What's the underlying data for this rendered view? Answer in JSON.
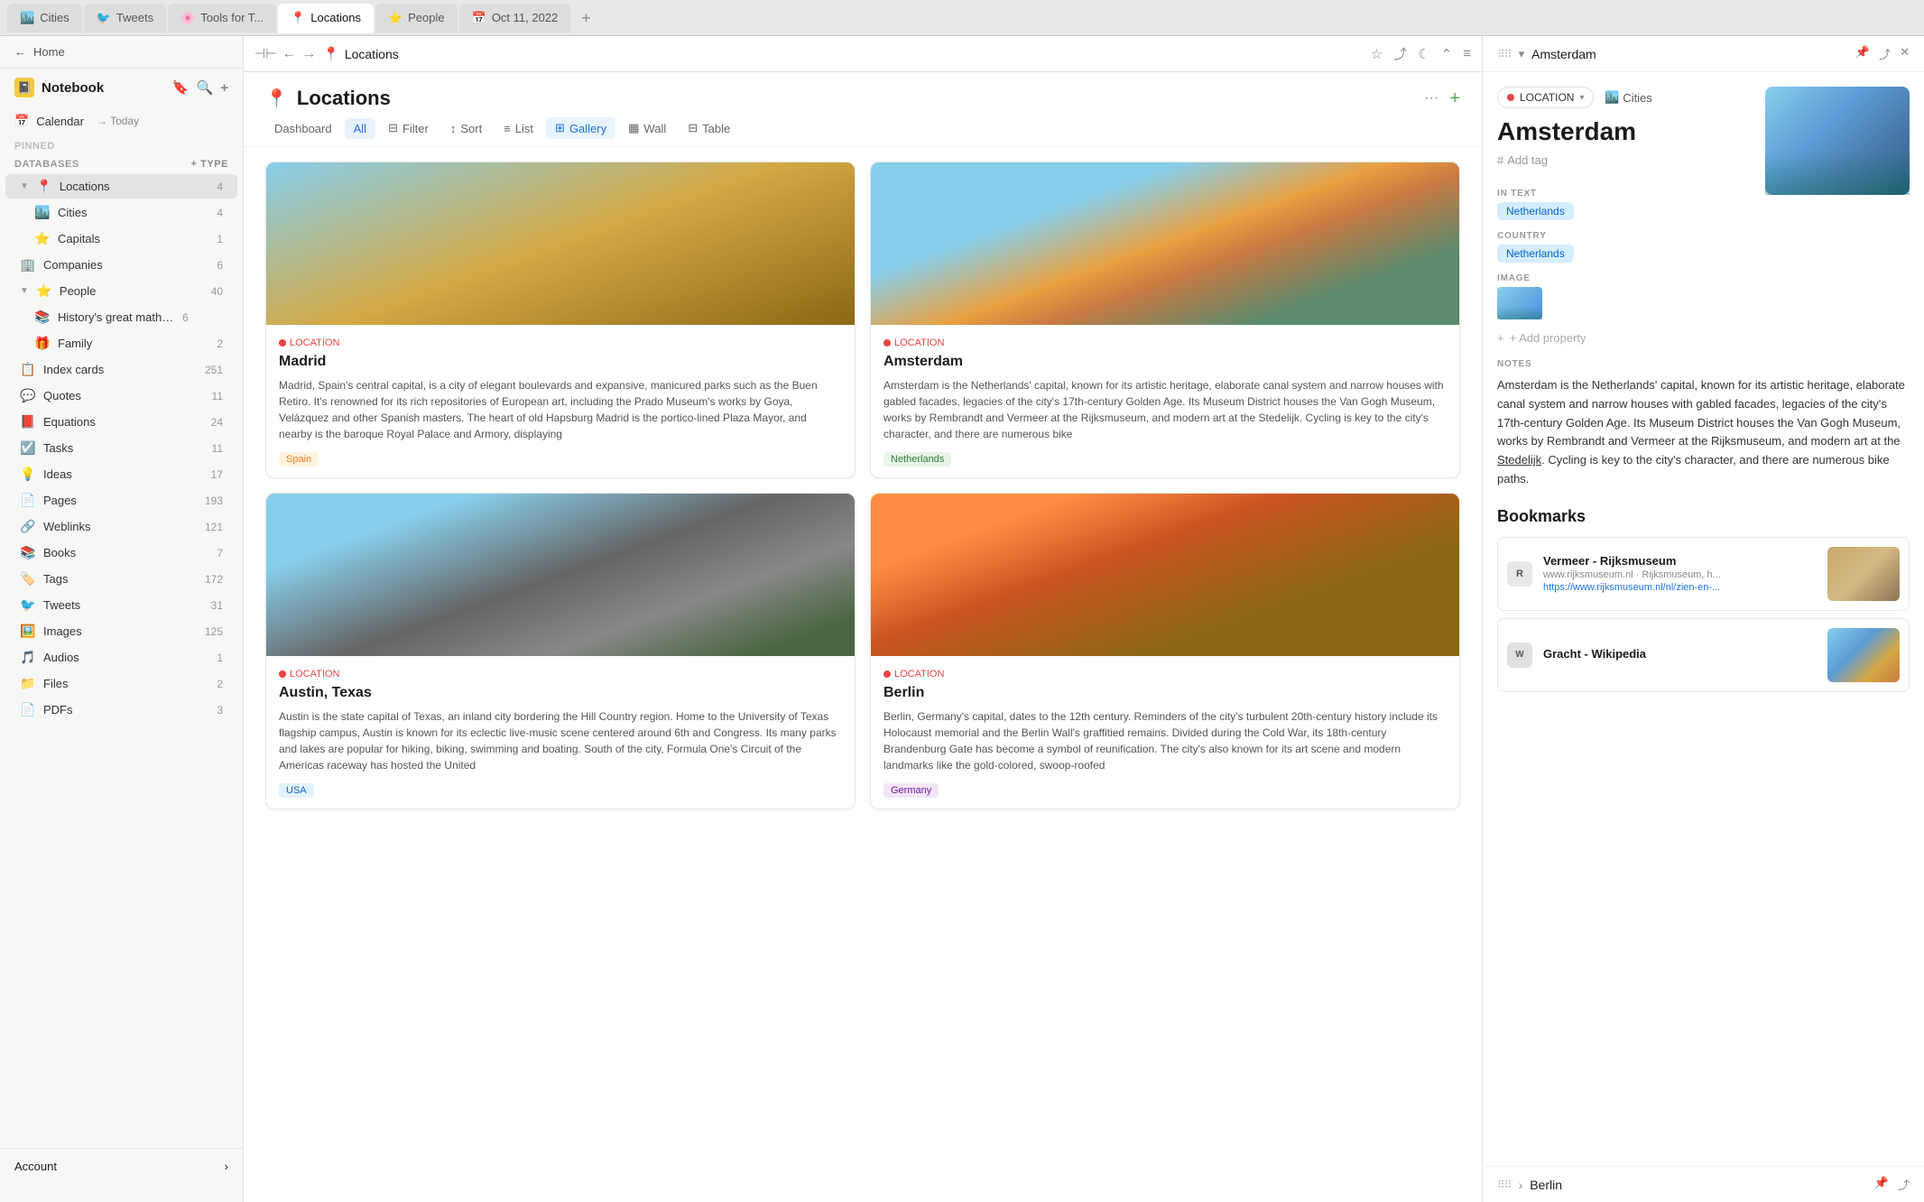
{
  "tabs": [
    {
      "id": "cities",
      "label": "Cities",
      "icon": "🏙️",
      "active": false
    },
    {
      "id": "tweets",
      "label": "Tweets",
      "icon": "🐦",
      "active": false
    },
    {
      "id": "tools",
      "label": "Tools for T...",
      "icon": "🌸",
      "active": false
    },
    {
      "id": "locations",
      "label": "Locations",
      "icon": "📍",
      "active": true
    },
    {
      "id": "people",
      "label": "People",
      "icon": "⭐",
      "active": false
    },
    {
      "id": "date",
      "label": "Oct 11, 2022",
      "icon": "📅",
      "active": false
    }
  ],
  "toolbar": {
    "back_icon": "←",
    "forward_icon": "→",
    "title": "Locations",
    "title_icon": "📍"
  },
  "sidebar": {
    "home_label": "Home",
    "notebook_label": "Notebook",
    "pinned_label": "PINNED",
    "databases_label": "DATABASES",
    "calendar_label": "Calendar",
    "today_label": "→ Today",
    "items": [
      {
        "id": "locations",
        "icon": "📍",
        "label": "Locations",
        "count": "4",
        "active": true,
        "expanded": true,
        "color": "#e84444"
      },
      {
        "id": "cities",
        "icon": "🏙️",
        "label": "Cities",
        "count": "4",
        "indent": 1
      },
      {
        "id": "capitals",
        "icon": "⭐",
        "label": "Capitals",
        "count": "1",
        "indent": 1
      },
      {
        "id": "companies",
        "icon": "🏢",
        "label": "Companies",
        "count": "6",
        "indent": 0
      },
      {
        "id": "people",
        "icon": "⭐",
        "label": "People",
        "count": "40",
        "expanded": true,
        "indent": 0
      },
      {
        "id": "history",
        "icon": "📚",
        "label": "History's great mathe...",
        "count": "6",
        "indent": 1
      },
      {
        "id": "family",
        "icon": "🎁",
        "label": "Family",
        "count": "2",
        "indent": 1
      },
      {
        "id": "index-cards",
        "icon": "📋",
        "label": "Index cards",
        "count": "251",
        "indent": 0
      },
      {
        "id": "quotes",
        "icon": "💬",
        "label": "Quotes",
        "count": "11",
        "indent": 0
      },
      {
        "id": "equations",
        "icon": "📕",
        "label": "Equations",
        "count": "24",
        "indent": 0
      },
      {
        "id": "tasks",
        "icon": "☑️",
        "label": "Tasks",
        "count": "11",
        "indent": 0
      },
      {
        "id": "ideas",
        "icon": "💡",
        "label": "Ideas",
        "count": "17",
        "indent": 0
      },
      {
        "id": "pages",
        "icon": "📄",
        "label": "Pages",
        "count": "193",
        "indent": 0
      },
      {
        "id": "weblinks",
        "icon": "🔗",
        "label": "Weblinks",
        "count": "121",
        "indent": 0
      },
      {
        "id": "books",
        "icon": "📚",
        "label": "Books",
        "count": "7",
        "indent": 0
      },
      {
        "id": "tags",
        "icon": "🏷️",
        "label": "Tags",
        "count": "172",
        "indent": 0
      },
      {
        "id": "tweets",
        "icon": "🐦",
        "label": "Tweets",
        "count": "31",
        "indent": 0
      },
      {
        "id": "images",
        "icon": "🖼️",
        "label": "Images",
        "count": "125",
        "indent": 0
      },
      {
        "id": "audios",
        "icon": "🎵",
        "label": "Audios",
        "count": "1",
        "indent": 0
      },
      {
        "id": "files",
        "icon": "📁",
        "label": "Files",
        "count": "2",
        "indent": 0
      },
      {
        "id": "pdfs",
        "icon": "📄",
        "label": "PDFs",
        "count": "3",
        "indent": 0
      }
    ],
    "account_label": "Account"
  },
  "page": {
    "title": "Locations",
    "title_icon": "📍",
    "view_tabs": [
      {
        "id": "dashboard",
        "label": "Dashboard",
        "active": false
      },
      {
        "id": "all",
        "label": "All",
        "active": true
      },
      {
        "id": "filter",
        "label": "Filter",
        "icon": "⊟",
        "active": false
      },
      {
        "id": "sort",
        "label": "Sort",
        "icon": "↕",
        "active": false
      },
      {
        "id": "list",
        "label": "List",
        "icon": "≡",
        "active": false
      },
      {
        "id": "gallery",
        "label": "Gallery",
        "icon": "⊞",
        "active": true
      },
      {
        "id": "wall",
        "label": "Wall",
        "icon": "▦",
        "active": false
      },
      {
        "id": "table",
        "label": "Table",
        "icon": "⊟",
        "active": false
      }
    ]
  },
  "cards": [
    {
      "id": "madrid",
      "badge": "LOCATION",
      "title": "Madrid",
      "description": "Madrid, Spain's central capital, is a city of elegant boulevards and expansive, manicured parks such as the Buen Retiro. It's renowned for its rich repositories of European art, including the Prado Museum's works by Goya, Velázquez and other Spanish masters. The heart of old Hapsburg Madrid is the portico-lined Plaza Mayor, and nearby is the baroque Royal Palace and Armory, displaying",
      "tag": "Spain",
      "tag_class": "spain",
      "img_class": "madrid-img"
    },
    {
      "id": "amsterdam",
      "badge": "LOCATION",
      "title": "Amsterdam",
      "description": "Amsterdam is the Netherlands' capital, known for its artistic heritage, elaborate canal system and narrow houses with gabled facades, legacies of the city's 17th-century Golden Age. Its Museum District houses the Van Gogh Museum, works by Rembrandt and Vermeer at the Rijksmuseum, and modern art at the Stedelijk. Cycling is key to the city's character, and there are numerous bike",
      "tag": "Netherlands",
      "tag_class": "netherlands",
      "img_class": "amsterdam-img"
    },
    {
      "id": "austin",
      "badge": "LOCATION",
      "title": "Austin, Texas",
      "description": "Austin is the state capital of Texas, an inland city bordering the Hill Country region. Home to the University of Texas flagship campus, Austin is known for its eclectic live-music scene centered around 6th and Congress. Its many parks and lakes are popular for hiking, biking, swimming and boating. South of the city, Formula One's Circuit of the Americas raceway has hosted the United",
      "tag": "USA",
      "tag_class": "usa",
      "img_class": "austin-img"
    },
    {
      "id": "berlin",
      "badge": "LOCATION",
      "title": "Berlin",
      "description": "Berlin, Germany's capital, dates to the 12th century. Reminders of the city's turbulent 20th-century history include its Holocaust memorial and the Berlin Wall's graffitied remains. Divided during the Cold War, its 18th-century Brandenburg Gate has become a symbol of reunification. The city's also known for its art scene and modern landmarks like the gold-colored, swoop-roofed",
      "tag": "Germany",
      "tag_class": "germany",
      "img_class": "berlin-img"
    }
  ],
  "right_panel": {
    "title": "Amsterdam",
    "city_title": "Amsterdam",
    "type_label": "LOCATION",
    "type_link": "Cities",
    "add_tag": "Add tag",
    "in_text_label": "IN TEXT",
    "in_text_value": "Netherlands",
    "country_label": "COUNTRY",
    "country_value": "Netherlands",
    "image_label": "IMAGE",
    "add_property": "+ Add property",
    "notes_label": "NOTES",
    "notes_text": "Amsterdam is the Netherlands' capital, known for its artistic heritage, elaborate canal system and narrow houses with gabled facades, legacies of the city's 17th-century Golden Age. Its Museum District houses the Van Gogh Museum, works by Rembrandt and Vermeer at the Rijksmuseum, and modern art at the Stedelijk. Cycling is key to the city's character, and there are numerous bike paths.",
    "bookmarks_title": "Bookmarks",
    "bookmarks": [
      {
        "id": "rijksmuseum",
        "name": "Vermeer - Rijksmuseum",
        "favicon_letter": "R",
        "domain": "www.rijksmuseum.nl · Rijksmuseum, h...",
        "url": "https://www.rijksmuseum.nl/nl/zien-en-...",
        "thumb_class": "rijksmuseum-thumb"
      },
      {
        "id": "gracht",
        "name": "Gracht - Wikipedia",
        "favicon_letter": "W",
        "domain": "",
        "url": "",
        "thumb_class": "gracht-thumb"
      }
    ],
    "footer_label": "Berlin"
  }
}
